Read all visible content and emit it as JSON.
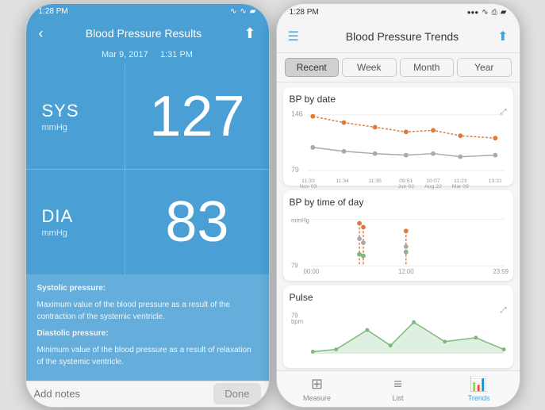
{
  "left_phone": {
    "status": {
      "time": "1:28 PM",
      "signal": "●●●○○",
      "wifi": "wifi",
      "battery": "battery"
    },
    "nav": {
      "title": "Blood Pressure Results",
      "back_label": "‹",
      "share_label": "⬆"
    },
    "date": "Mar 9, 2017",
    "time": "1:31 PM",
    "sys": {
      "label": "SYS",
      "unit": "mmHg",
      "value": "127"
    },
    "dia": {
      "label": "DIA",
      "unit": "mmHg",
      "value": "83"
    },
    "info": {
      "systolic_title": "Systolic pressure:",
      "systolic_desc": "Maximum value of the blood pressure as a result of the contraction of the systemic ventricle.",
      "diastolic_title": "Diastolic pressure:",
      "diastolic_desc": "Minimum value of the blood pressure as a result of relaxation of the systemic ventricle."
    },
    "notes_placeholder": "Add notes",
    "done_label": "Done"
  },
  "right_phone": {
    "status": {
      "time": "1:28 PM"
    },
    "nav": {
      "title": "Blood Pressure Trends"
    },
    "tabs": [
      "Recent",
      "Week",
      "Month",
      "Year"
    ],
    "active_tab": "Recent",
    "charts": {
      "bp_date": {
        "title": "BP by date",
        "y_min": "79",
        "y_max": "146",
        "x_labels": [
          "11:33\nNov 03",
          "11:34",
          "11:35",
          "09:51\nJun 02",
          "10:07\nAug 22",
          "11:23\nMar 09",
          "13:31"
        ]
      },
      "bp_time": {
        "title": "BP by time of day",
        "y_min": "79",
        "y_label": "mmHg",
        "x_labels": [
          "00:00",
          "12:00",
          "23:59"
        ]
      },
      "pulse": {
        "title": "Pulse",
        "y_min": "79",
        "y_label": "bpm"
      }
    },
    "bottom_tabs": [
      {
        "label": "Measure",
        "icon": "measure",
        "active": false
      },
      {
        "label": "List",
        "icon": "list",
        "active": false
      },
      {
        "label": "Trends",
        "icon": "trends",
        "active": true
      }
    ]
  }
}
